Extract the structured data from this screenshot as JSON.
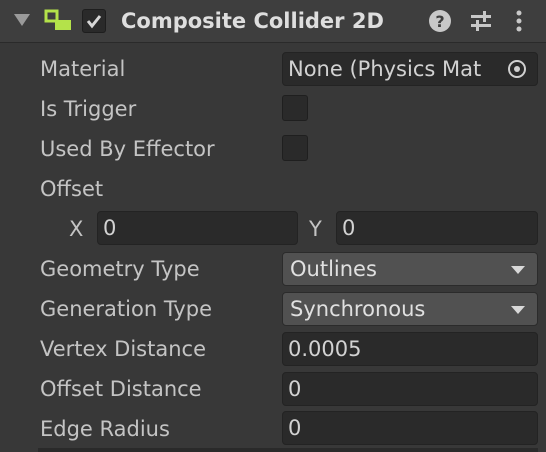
{
  "component": {
    "title": "Composite Collider 2D",
    "enabled": true,
    "icons": {
      "collapse": "triangle-down-icon",
      "component": "composite-collider-icon",
      "help": "help-icon",
      "presets": "sliders-icon",
      "menu": "kebab-menu-icon"
    }
  },
  "fields": {
    "material": {
      "label": "Material",
      "value": "None (Physics Mat"
    },
    "is_trigger": {
      "label": "Is Trigger",
      "checked": false
    },
    "used_by_effector": {
      "label": "Used By Effector",
      "checked": false
    },
    "offset": {
      "label": "Offset",
      "x_label": "X",
      "x_value": "0",
      "y_label": "Y",
      "y_value": "0"
    },
    "geometry_type": {
      "label": "Geometry Type",
      "value": "Outlines"
    },
    "generation_type": {
      "label": "Generation Type",
      "value": "Synchronous"
    },
    "vertex_distance": {
      "label": "Vertex Distance",
      "value": "0.0005"
    },
    "offset_distance": {
      "label": "Offset Distance",
      "value": "0"
    },
    "edge_radius": {
      "label": "Edge Radius",
      "value": "0"
    }
  },
  "colors": {
    "background": "#383838",
    "header": "#3e3e3e",
    "field": "#2a2a2a",
    "dropdown": "#515151",
    "accent_green": "#b4e24a"
  }
}
